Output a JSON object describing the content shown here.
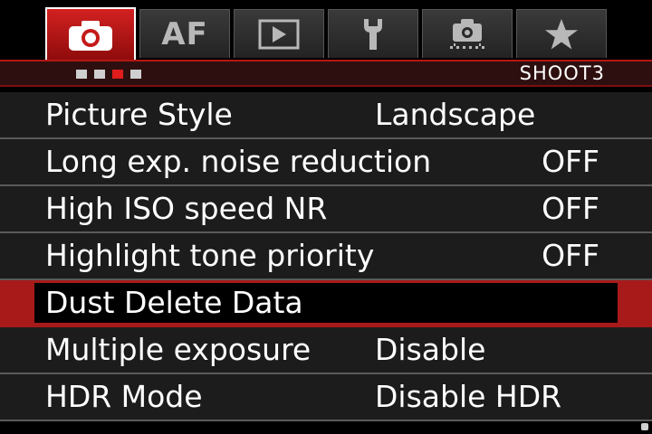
{
  "tabs": [
    {
      "id": "shoot",
      "icon": "camera-icon",
      "active": true
    },
    {
      "id": "af",
      "label": "AF",
      "active": false
    },
    {
      "id": "playback",
      "icon": "play-icon",
      "active": false
    },
    {
      "id": "setup",
      "icon": "wrench-icon",
      "active": false
    },
    {
      "id": "custom",
      "icon": "custom-function-camera-icon",
      "active": false
    },
    {
      "id": "mymenu",
      "icon": "star-icon",
      "active": false
    }
  ],
  "page_indicator": {
    "total_pages": 4,
    "current_page": 3
  },
  "menu_name": "SHOOT3",
  "menu_items": [
    {
      "label": "Picture Style",
      "value": "Landscape",
      "selected": false
    },
    {
      "label": "Long exp. noise reduction",
      "value": "OFF",
      "selected": false
    },
    {
      "label": "High ISO speed NR",
      "value": "OFF",
      "selected": false
    },
    {
      "label": "Highlight tone priority",
      "value": "OFF",
      "selected": false
    },
    {
      "label": "Dust Delete Data",
      "value": "",
      "selected": true
    },
    {
      "label": "Multiple exposure",
      "value": "Disable",
      "selected": false
    },
    {
      "label": "HDR Mode",
      "value": "Disable HDR",
      "selected": false
    }
  ],
  "colors": {
    "accent_red": "#c41a1a",
    "background": "#000000",
    "row_background": "#1c1c1c",
    "text": "#ffffff"
  }
}
